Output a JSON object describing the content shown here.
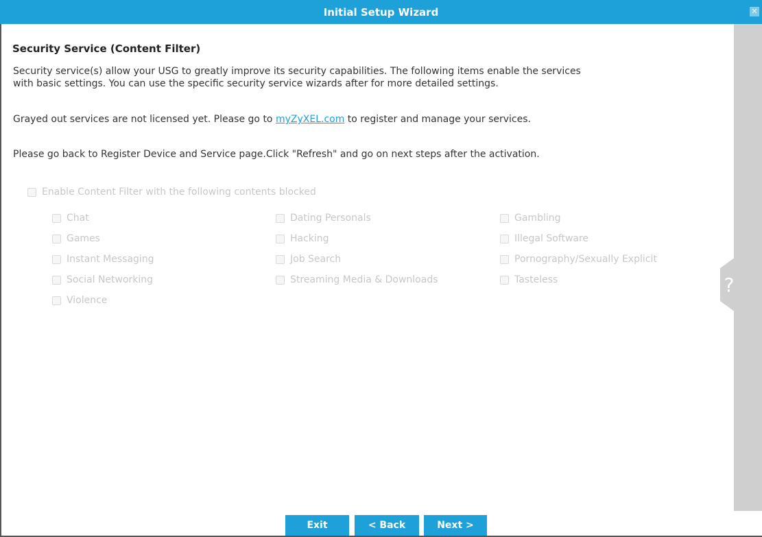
{
  "window": {
    "title": "Initial Setup Wizard",
    "close_glyph": "✕"
  },
  "section": {
    "title": "Security Service (Content Filter)",
    "intro_line1": "Security service(s) allow your USG to greatly improve its security capabilities. The following items enable the services",
    "intro_line2": "with basic settings. You can use the specific security service wizards after for more detailed settings.",
    "license_before": "Grayed out services are not licensed yet. Please go to ",
    "license_link": "myZyXEL.com",
    "license_after": " to register and manage your services.",
    "refresh_note": "Please go back to Register Device and Service page.Click \"Refresh\" and go on next steps after the activation."
  },
  "content_filter": {
    "enable_label": "Enable Content Filter with the following contents blocked",
    "categories": [
      "Chat",
      "Dating Personals",
      "Gambling",
      "Games",
      "Hacking",
      "Illegal Software",
      "Instant Messaging",
      "Job Search",
      "Pornography/Sexually Explicit",
      "Social Networking",
      "Streaming Media & Downloads",
      "Tasteless",
      "Violence"
    ]
  },
  "help": {
    "glyph": "?"
  },
  "buttons": {
    "exit": "Exit",
    "back": "< Back",
    "next": "Next >"
  },
  "colors": {
    "accent": "#1ea1d9",
    "disabled_text": "#c7c7c7",
    "side_panel": "#cfcfcf"
  }
}
